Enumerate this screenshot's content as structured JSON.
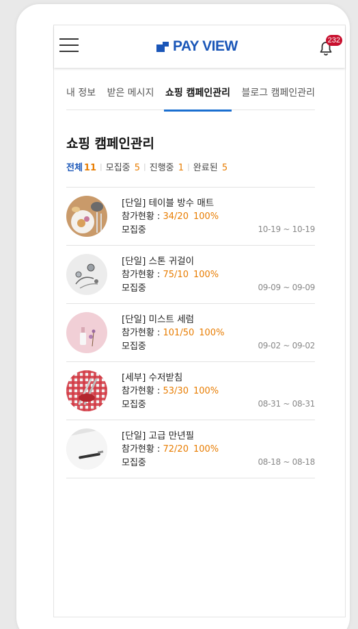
{
  "header": {
    "logo_text": "PAY VIEW",
    "notification_count": "232",
    "brand_color": "#1a56b8",
    "badge_color": "#c8102e"
  },
  "tabs": [
    {
      "label": "내 정보",
      "active": false
    },
    {
      "label": "받은 메시지",
      "active": false
    },
    {
      "label": "쇼핑 캠페인관리",
      "active": true
    },
    {
      "label": "블로그 캠페인관리",
      "active": false
    }
  ],
  "page_title": "쇼핑 캠페인관리",
  "filters": [
    {
      "label": "전체",
      "count": "11",
      "active": true
    },
    {
      "label": "모집중",
      "count": "5",
      "active": false
    },
    {
      "label": "진행중",
      "count": "1",
      "active": false
    },
    {
      "label": "완료된",
      "count": "5",
      "active": false
    }
  ],
  "accent_color": "#e87c00",
  "campaigns": [
    {
      "title": "[단일] 테이블 방수 매트",
      "participation_label": "참가현황 : ",
      "participation_value": "34/20",
      "participation_percent": "100%",
      "status": "모집중",
      "date_range": "10-19 ~ 10-19",
      "thumb_icon": "table-mat-photo"
    },
    {
      "title": "[단일] 스톤 귀걸이",
      "participation_label": "참가현황 : ",
      "participation_value": "75/10",
      "participation_percent": "100%",
      "status": "모집중",
      "date_range": "09-09 ~ 09-09",
      "thumb_icon": "earring-photo"
    },
    {
      "title": "[단일] 미스트 세럼",
      "participation_label": "참가현황 : ",
      "participation_value": "101/50",
      "participation_percent": "100%",
      "status": "모집중",
      "date_range": "09-02 ~ 09-02",
      "thumb_icon": "serum-photo"
    },
    {
      "title": "[세부] 수저받침",
      "participation_label": "참가현황 : ",
      "participation_value": "53/30",
      "participation_percent": "100%",
      "status": "모집중",
      "date_range": "08-31 ~ 08-31",
      "thumb_icon": "spoon-rest-photo"
    },
    {
      "title": "[단일] 고급 만년필",
      "participation_label": "참가현황 : ",
      "participation_value": "72/20",
      "participation_percent": "100%",
      "status": "모집중",
      "date_range": "08-18 ~ 08-18",
      "thumb_icon": "fountain-pen-photo"
    }
  ]
}
